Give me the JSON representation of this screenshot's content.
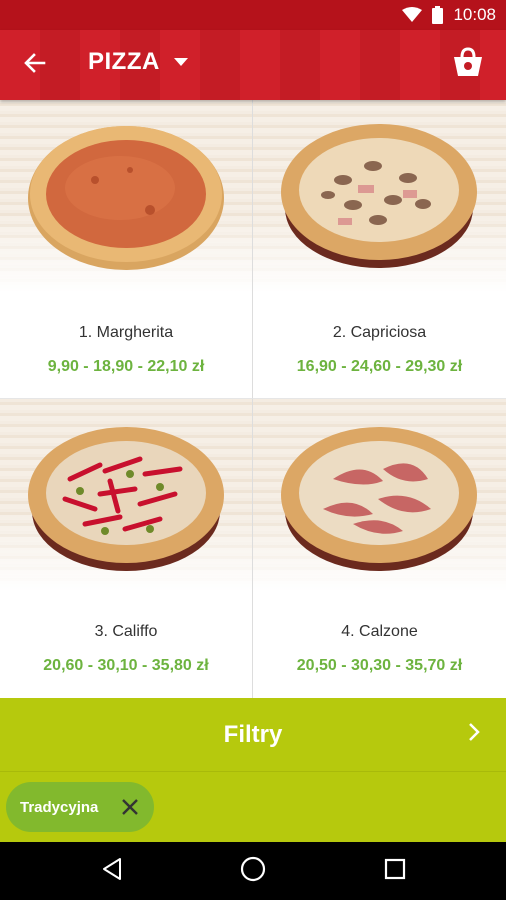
{
  "status_bar": {
    "time": "10:08"
  },
  "header": {
    "title": "PIZZA"
  },
  "products": [
    {
      "name": "1. Margherita",
      "price": "9,90 - 18,90 - 22,10 zł"
    },
    {
      "name": "2. Capriciosa",
      "price": "16,90 - 24,60 - 29,30 zł"
    },
    {
      "name": "3. Califfo",
      "price": "20,60 - 30,10 - 35,80 zł"
    },
    {
      "name": "4. Calzone",
      "price": "20,50 - 30,30 - 35,70 zł"
    }
  ],
  "filter": {
    "label": "Filtry"
  },
  "chips": [
    {
      "label": "Tradycyjna"
    }
  ],
  "colors": {
    "header_red": "#d0202a",
    "status_red": "#b5121b",
    "filter_green": "#b6c90d",
    "price_green": "#6db33f",
    "chip_green": "#82b92d"
  },
  "icons": [
    "wifi-icon",
    "battery-icon",
    "back-arrow-icon",
    "dropdown-caret-icon",
    "shopping-basket-icon",
    "chevron-right-icon",
    "close-icon",
    "nav-back-icon",
    "nav-home-icon",
    "nav-recents-icon"
  ]
}
